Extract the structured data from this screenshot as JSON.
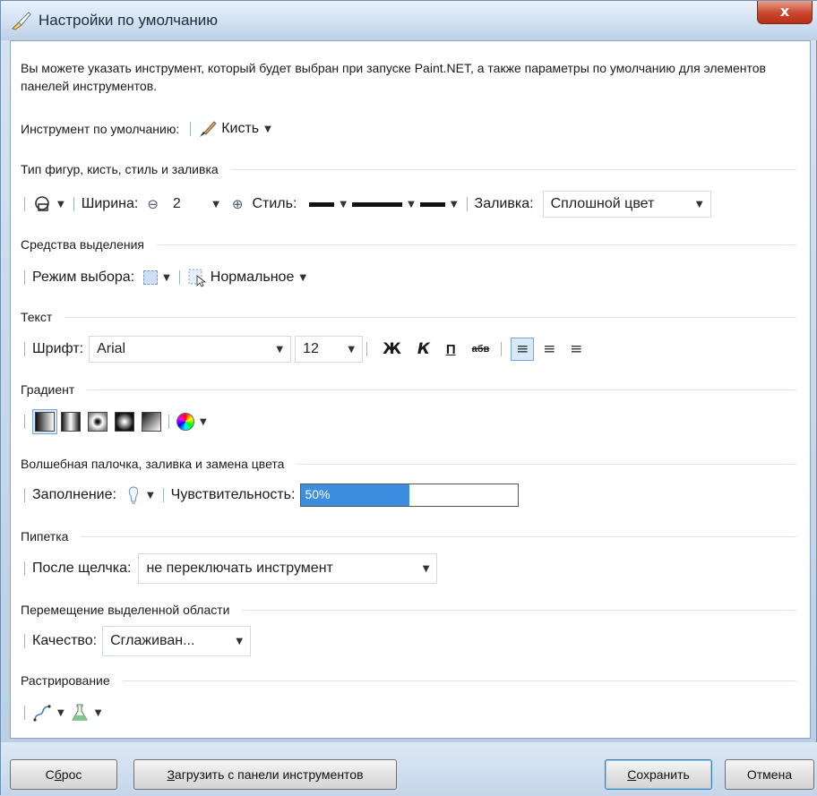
{
  "window": {
    "title": "Настройки по умолчанию",
    "close_label": "x"
  },
  "intro_text": "Вы можете указать инструмент, который будет выбран при запуске Paint.NET, а также параметры по умолчанию для элементов панелей инструментов.",
  "default_tool": {
    "label": "Инструмент по умолчанию:",
    "value": "Кисть"
  },
  "shapes_section": {
    "header": "Тип фигур, кисть, стиль и заливка",
    "width_label": "Ширина:",
    "width_value": "2",
    "style_label": "Стиль:",
    "fill_label": "Заливка:",
    "fill_value": "Сплошной цвет"
  },
  "selection_section": {
    "header": "Средства выделения",
    "mode_label": "Режим выбора:",
    "mode_value": "Нормальное"
  },
  "text_section": {
    "header": "Текст",
    "font_label": "Шрифт:",
    "font_value": "Arial",
    "size_value": "12",
    "bold": "Ж",
    "italic": "К",
    "underline": "П",
    "strikethrough": "абв"
  },
  "gradient_section": {
    "header": "Градиент"
  },
  "wand_section": {
    "header": "Волшебная палочка, заливка и замена цвета",
    "flood_label": "Заполнение:",
    "tolerance_label": "Чувствительность:",
    "tolerance_value": "50%",
    "tolerance_percent": 50
  },
  "picker_section": {
    "header": "Пипетка",
    "after_click_label": "После щелчка:",
    "after_click_value": "не переключать инструмент"
  },
  "move_section": {
    "header": "Перемещение выделенной области",
    "quality_label": "Качество:",
    "quality_value": "Сглаживан..."
  },
  "raster_section": {
    "header": "Растрирование"
  },
  "buttons": {
    "reset_pre": "С",
    "reset_u": "б",
    "reset_post": "рос",
    "load_u": "З",
    "load_post": "агрузить с панели инструментов",
    "save_u": "С",
    "save_post": "охранить",
    "cancel": "Отмена"
  },
  "colors": {
    "accent": "#3c8ee0",
    "close_button": "#c8452c",
    "frame": "#b9cde4"
  }
}
